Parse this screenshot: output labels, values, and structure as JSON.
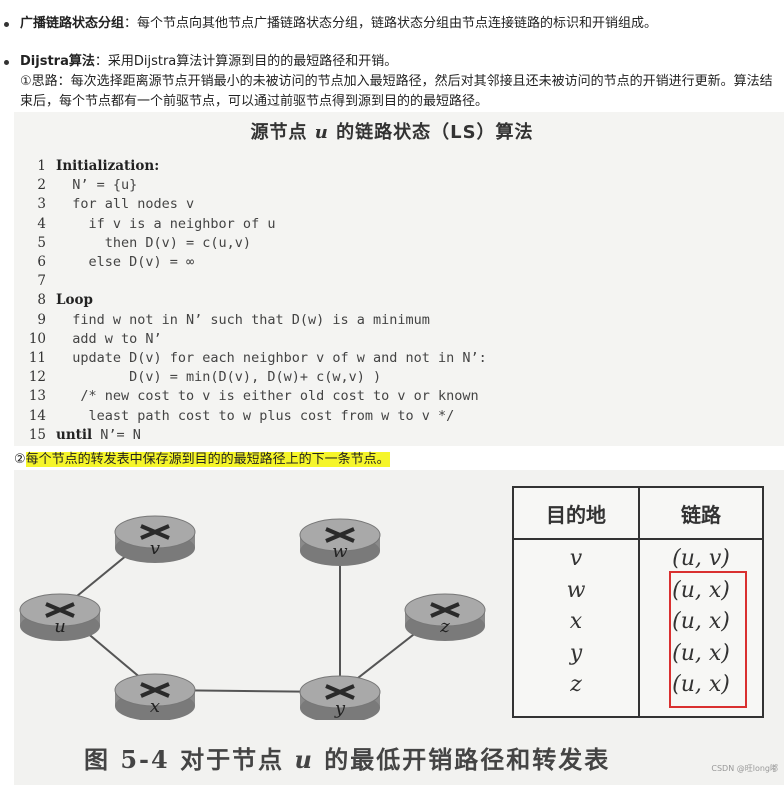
{
  "bullets": [
    {
      "term": "广播链路状态分组",
      "text": "：每个节点向其他节点广播链路状态分组，链路状态分组由节点连接链路的标识和开销组成。"
    },
    {
      "term": "Dijstra算法",
      "text": "：采用Dijstra算法计算源到目的的最短路径和开销。"
    }
  ],
  "idea_lines": [
    "①思路：每次选择距离源节点开销最小的未被访问的节点加入最短路径，然后对其邻接且还未被访问的节点的开销进行更新。算法结",
    "束后，每个节点都有一个前驱节点，可以通过前驱节点得到源到目的的最短路径。"
  ],
  "algo_title_pre": "源节点 ",
  "algo_title_var": "u",
  "algo_title_post": " 的链路状态（LS）算法",
  "code": [
    {
      "n": "1",
      "kw": "Initialization:",
      "t": ""
    },
    {
      "n": "2",
      "kw": "",
      "t": "  N’ = {u}"
    },
    {
      "n": "3",
      "kw": "",
      "t": "  for all nodes v"
    },
    {
      "n": "4",
      "kw": "",
      "t": "    if v is a neighbor of u"
    },
    {
      "n": "5",
      "kw": "",
      "t": "      then D(v) = c(u,v)"
    },
    {
      "n": "6",
      "kw": "",
      "t": "    else D(v) = ∞"
    },
    {
      "n": "7",
      "kw": "",
      "t": ""
    },
    {
      "n": "8",
      "kw": "Loop",
      "t": ""
    },
    {
      "n": "9",
      "kw": "",
      "t": "  find w not in N’ such that D(w) is a minimum"
    },
    {
      "n": "10",
      "kw": "",
      "t": "  add w to N’"
    },
    {
      "n": "11",
      "kw": "",
      "t": "  update D(v) for each neighbor v of w and not in N’:"
    },
    {
      "n": "12",
      "kw": "",
      "t": "         D(v) = min(D(v), D(w)+ c(w,v) )"
    },
    {
      "n": "13",
      "kw": "",
      "t": "   /* new cost to v is either old cost to v or known"
    },
    {
      "n": "14",
      "kw": "",
      "t": "    least path cost to w plus cost from w to v */"
    },
    {
      "n": "15",
      "kw": "until",
      "t": " N’= N"
    }
  ],
  "highlight_prefix": "②",
  "highlight_text": "每个节点的转发表中保存源到目的的最短路径上的下一条节点。",
  "graph_nodes": [
    "v",
    "w",
    "u",
    "z",
    "x",
    "y"
  ],
  "table": {
    "headers": [
      "目的地",
      "链路"
    ],
    "rows": [
      {
        "dest": "v",
        "link": "(u, v)"
      },
      {
        "dest": "w",
        "link": "(u, x)"
      },
      {
        "dest": "x",
        "link": "(u, x)"
      },
      {
        "dest": "y",
        "link": "(u, x)"
      },
      {
        "dest": "z",
        "link": "(u, x)"
      }
    ]
  },
  "caption_pre": "图 5-4    对于节点 ",
  "caption_var": "u",
  "caption_post": " 的最低开销路径和转发表",
  "csdn": "CSDN @旺long嘟",
  "colors": {
    "highlight": "#f5f52a",
    "redbox": "#d93030",
    "panel": "#f4f4f2"
  }
}
